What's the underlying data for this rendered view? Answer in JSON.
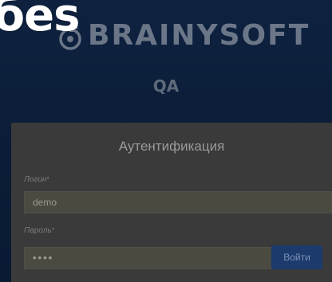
{
  "overlay": {
    "title": "бes"
  },
  "brand": {
    "logo_icon": "brainysoft-logo-icon",
    "name": "BRAINYSOFT",
    "subtitle": "QA"
  },
  "auth": {
    "title": "Аутентификация",
    "login_label": "Логин",
    "login_value": "demo",
    "password_label": "Пароль",
    "password_value": "••••",
    "required_mark": "*",
    "submit_label": "Войти"
  },
  "colors": {
    "background": "#0b1c36",
    "button": "#1c3a6b",
    "card": "#3a3a3a"
  }
}
